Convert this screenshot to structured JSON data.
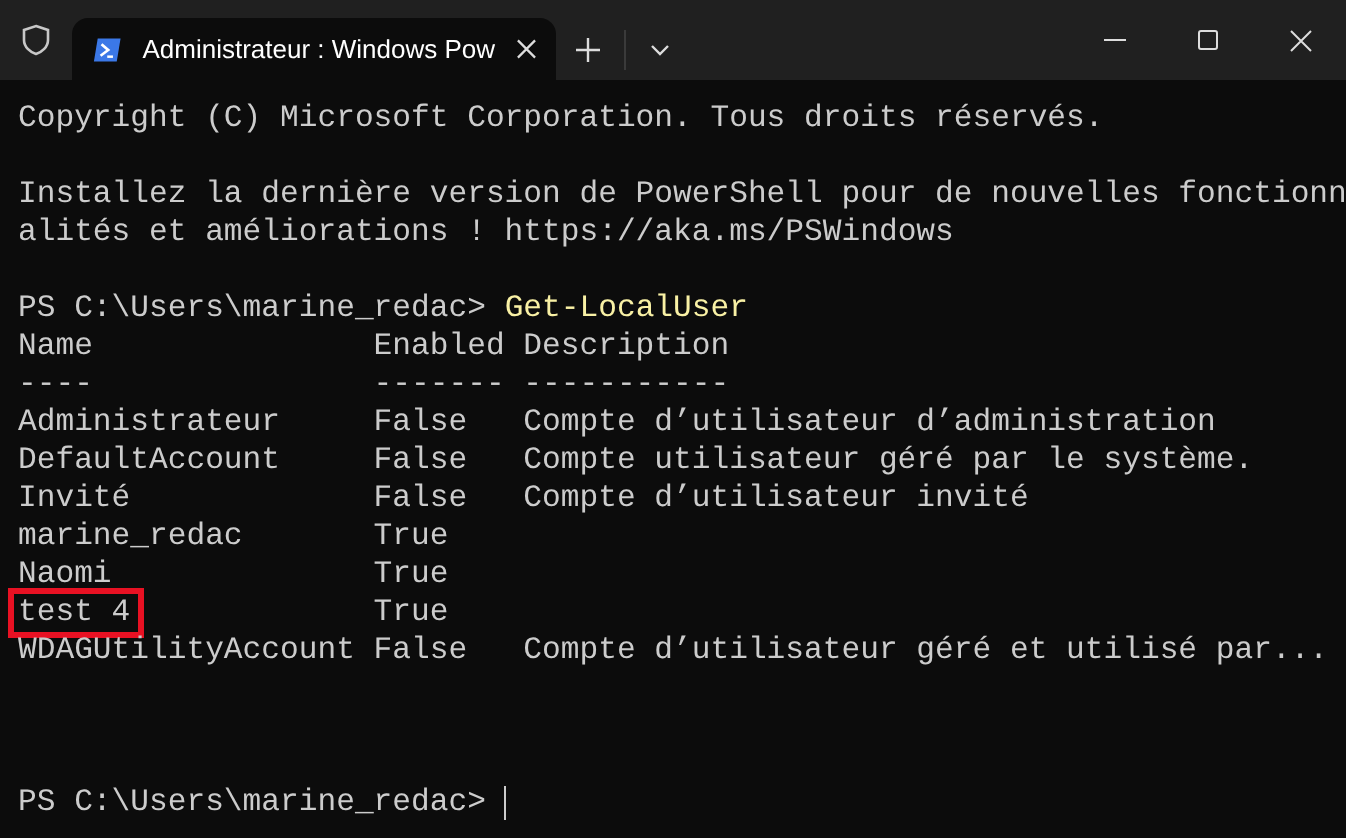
{
  "tab": {
    "title": "Administrateur : Windows Pow",
    "selected": true
  },
  "terminal": {
    "intro": [
      "Copyright (C) Microsoft Corporation. Tous droits réservés.",
      "Installez la dernière version de PowerShell pour de nouvelles fonctionn",
      "alités et améliorations ! https://aka.ms/PSWindows"
    ],
    "command_prompt": {
      "prompt": "PS C:\\Users\\marine_redac>",
      "command": "Get-LocalUser"
    },
    "table": {
      "columns": [
        {
          "title": "Name",
          "rule": "----"
        },
        {
          "title": "Enabled",
          "rule": "-------"
        },
        {
          "title": "Description",
          "rule": "-----------"
        }
      ],
      "rows": [
        {
          "name": "Administrateur",
          "enabled": "False",
          "description": "Compte d’utilisateur d’administration",
          "highlighted": false
        },
        {
          "name": "DefaultAccount",
          "enabled": "False",
          "description": "Compte utilisateur géré par le système.",
          "highlighted": false
        },
        {
          "name": "Invité",
          "enabled": "False",
          "description": "Compte d’utilisateur invité",
          "highlighted": false
        },
        {
          "name": "marine_redac",
          "enabled": "True",
          "highlighted": false
        },
        {
          "name": "Naomi",
          "enabled": "True",
          "highlighted": false
        },
        {
          "name": "test 4",
          "enabled": "True",
          "highlighted": true
        },
        {
          "name": "WDAGUtilityAccount",
          "enabled": "False",
          "description": "Compte d’utilisateur géré et utilisé par...",
          "highlighted": false
        }
      ]
    },
    "final_prompt": {
      "prompt": "PS C:\\Users\\marine_redac>",
      "cursor": true
    }
  }
}
